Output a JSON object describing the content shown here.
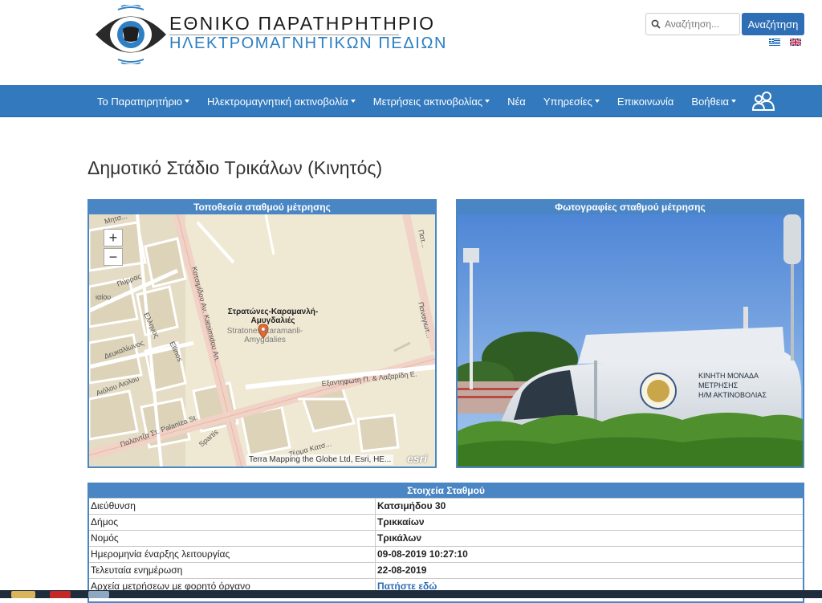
{
  "header": {
    "logo_line1": "ΕΘΝΙΚΟ ΠΑΡΑΤΗΡΗΤΗΡΙΟ",
    "logo_line2": "ΗΛΕΚΤΡΟΜΑΓΝΗΤΙΚΩΝ ΠΕΔΙΩΝ",
    "search_placeholder": "Αναζήτηση...",
    "search_button": "Αναζήτηση",
    "accent_color": "#3279bd"
  },
  "nav": {
    "items": [
      {
        "label": "Το Παρατηρητήριο",
        "dropdown": true
      },
      {
        "label": "Ηλεκτρομαγνητική ακτινοβολία",
        "dropdown": true
      },
      {
        "label": "Μετρήσεις ακτινοβολίας",
        "dropdown": true
      },
      {
        "label": "Νέα",
        "dropdown": false
      },
      {
        "label": "Υπηρεσίες",
        "dropdown": true
      },
      {
        "label": "Επικοινωνία",
        "dropdown": false
      },
      {
        "label": "Βοήθεια",
        "dropdown": true
      }
    ]
  },
  "page": {
    "title": "Δημοτικό Στάδιο Τρικάλων (Κινητός)"
  },
  "map_panel": {
    "heading": "Τοποθεσία σταθμού μέτρησης",
    "zoom_in": "+",
    "zoom_out": "−",
    "place_label_el": "Στρατώνες-Καραμανλή-Αμυγδαλιές",
    "place_label_en": "Stratones-Karamanli-Amygdalies",
    "attribution": "Terra Mapping the Globe Ltd, Esri, HE...",
    "esri": "esri",
    "streets": [
      "Πύρρας",
      "Ελληνος",
      "Δευκαλίωνος",
      "Αιόλου",
      "Καπακτσηδου Αν.",
      "Katsimidou An.",
      "Παλαντζα Στ.",
      "Palaniza St.",
      "Εξαντηφωτη Π. & Λαζαρίδη Ε.",
      "Παναγιωτ...",
      "Spartis",
      "Τέρμα Κατσ..."
    ]
  },
  "photo_panel": {
    "heading": "Φωτογραφίες σταθμού μέτρησης",
    "van_text": [
      "ΚΙΝΗΤΗ ΜΟΝΑΔΑ",
      "ΜΕΤΡΗΣΗΣ",
      "Η/Μ ΑΚΤΙΝΟΒΟΛΙΑΣ"
    ]
  },
  "station": {
    "heading": "Στοιχεία Σταθμού",
    "rows": [
      {
        "label": "Διεύθυνση",
        "value": "Κατσιμήδου 30"
      },
      {
        "label": "Δήμος",
        "value": "Τρικκαίων"
      },
      {
        "label": "Νομός",
        "value": "Τρικάλων"
      },
      {
        "label": "Ημερομηνία έναρξης λειτουργίας",
        "value": "09-08-2019 10:27:10"
      },
      {
        "label": "Τελευταία ενημέρωση",
        "value": "22-08-2019"
      },
      {
        "label": "Αρχεία μετρήσεων με φορητό όργανο",
        "value": "Πατήστε εδώ"
      }
    ]
  }
}
